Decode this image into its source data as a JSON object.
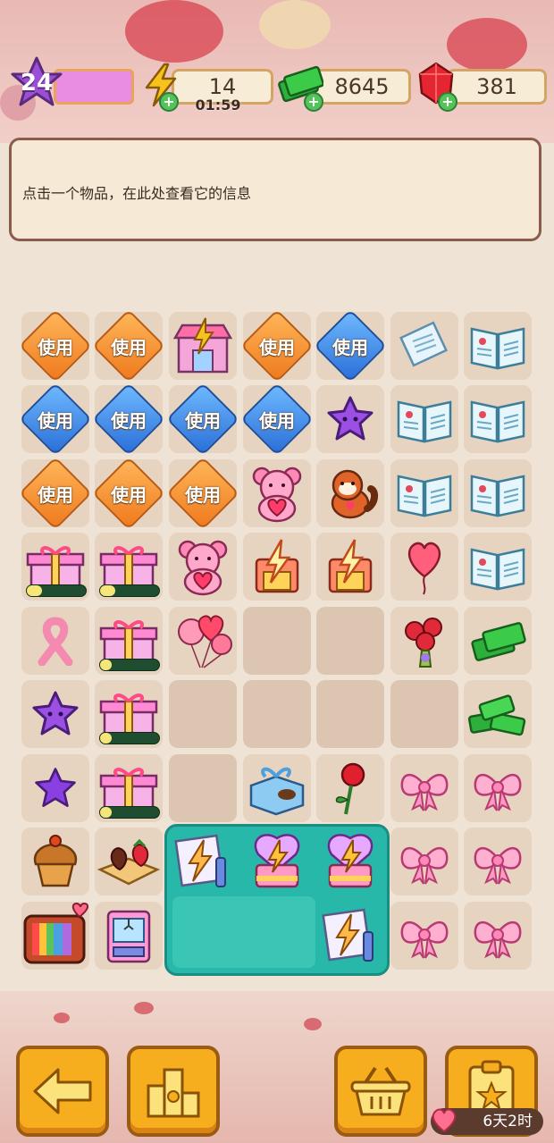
{
  "header": {
    "level": "24",
    "energy": "14",
    "energy_timer": "01:59",
    "cash": "8645",
    "gems": "381"
  },
  "info_panel": {
    "text": "点击一个物品，在此处查看它的信息"
  },
  "board": {
    "use_label": "使用",
    "rows": [
      [
        "use-orange",
        "use-orange",
        "lightning-shop",
        "use-orange",
        "use-blue",
        "letter",
        "book"
      ],
      [
        "use-blue",
        "use-blue",
        "use-blue",
        "use-blue",
        "purple-star",
        "book",
        "book"
      ],
      [
        "use-orange",
        "use-orange",
        "use-orange",
        "teddy-bear",
        "red-panda",
        "book",
        "book"
      ],
      [
        "gift-box",
        "gift-box",
        "teddy-bear",
        "energy-tower",
        "energy-tower",
        "heart-balloon",
        "book"
      ],
      [
        "pink-ribbon",
        "gift-box",
        "balloons",
        "empty",
        "empty",
        "rose-bouquet",
        "cash-stack"
      ],
      [
        "purple-star",
        "gift-box",
        "empty",
        "empty",
        "empty",
        "empty",
        "cash-pile"
      ],
      [
        "purple-star-small",
        "gift-box",
        "empty",
        "chocolate-box",
        "rose",
        "pink-bow",
        "pink-bow"
      ],
      [
        "cupcake",
        "strawberry-tray",
        "lightning-letter",
        "lightning-cake",
        "lightning-cake",
        "pink-bow",
        "pink-bow"
      ],
      [
        "retro-tv",
        "claw-machine",
        "empty",
        "empty",
        "lightning-letter",
        "pink-bow",
        "pink-bow"
      ]
    ],
    "progress": [
      {
        "row": 3,
        "col": 0,
        "value": 0.25
      },
      {
        "row": 3,
        "col": 1,
        "value": 0.25
      },
      {
        "row": 4,
        "col": 1,
        "value": 0.2
      },
      {
        "row": 5,
        "col": 1,
        "value": 0.2
      },
      {
        "row": 6,
        "col": 1,
        "value": 0.2
      }
    ]
  },
  "bottom_bar": {
    "buttons": [
      "back-arrow-icon",
      "trophy-icon",
      "basket-icon",
      "task-board-icon"
    ],
    "event_timer": "6天2时"
  },
  "colors": {
    "accent_orange": "#f7ae1e",
    "panel_border": "#8c5c4a",
    "teal_zone": "#27b8a9"
  }
}
